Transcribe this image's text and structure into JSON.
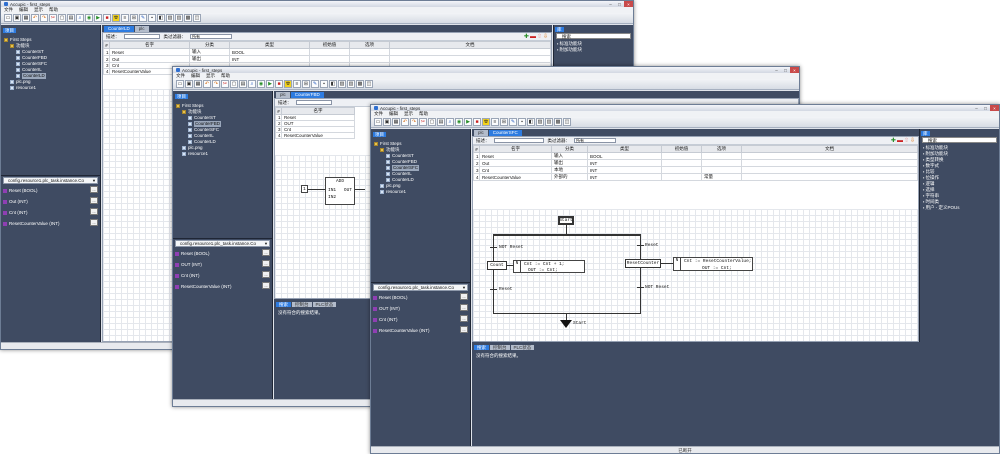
{
  "app": {
    "title": "Accupic - first_steps",
    "menu": [
      "文件",
      "编辑",
      "显示",
      "帮助"
    ]
  },
  "toolbar_glyphs": [
    "▭",
    "▣",
    "▦",
    "↶",
    "↷",
    "✂",
    "▢",
    "▤",
    "⌕",
    "◉",
    "▶",
    "■",
    "☢",
    "≡",
    "⊞",
    "✎",
    "▪",
    "◧",
    "▨",
    "▥",
    "▩",
    "◫"
  ],
  "tree": {
    "tab": "项目",
    "root": "First Steps",
    "folder": "功能块",
    "items": [
      "CounterST",
      "CounterFBD",
      "CounterSFC",
      "CounterIL",
      "CounterLD"
    ],
    "extra": [
      "plc.png",
      "resource1"
    ]
  },
  "windows": [
    {
      "doc_tab_active": "CounterLD",
      "doc_tab_other": "plc",
      "selected_item": "CounterLD"
    },
    {
      "doc_tab_active": "CounterFBD",
      "doc_tab_other": "plc",
      "selected_item": "CounterFBD"
    },
    {
      "doc_tab_active": "CounterSFC",
      "doc_tab_other": "plc",
      "selected_item": "CounterSFC"
    }
  ],
  "filter": {
    "label": "描述：",
    "class_label": "类过滤器：",
    "class_value": "所有"
  },
  "table": {
    "headers": [
      "#",
      "名字",
      "分类",
      "类型",
      "初始值",
      "选项",
      "文档"
    ],
    "rows": [
      [
        "1",
        "Reset",
        "输入",
        "BOOL",
        "",
        "",
        ""
      ],
      [
        "2",
        "Out",
        "输出",
        "INT",
        "",
        "",
        ""
      ],
      [
        "3",
        "Cnt",
        "本地",
        "INT",
        "",
        "",
        ""
      ],
      [
        "4",
        "ResetCounterValue",
        "外部的",
        "INT",
        "",
        "常量",
        ""
      ]
    ],
    "w1_rows": [
      [
        "1",
        "Reset",
        "输入",
        "BOOL",
        "",
        "",
        ""
      ],
      [
        "2",
        "Out",
        "输出",
        "INT",
        "",
        "",
        ""
      ],
      [
        "3",
        "Cnt",
        "",
        "",
        "",
        "",
        ""
      ],
      [
        "4",
        "ResetCounterValue",
        "",
        "",
        "",
        "",
        ""
      ]
    ],
    "w2_rows": [
      [
        "1",
        "Reset"
      ],
      [
        "2",
        "OUT"
      ],
      [
        "3",
        "Cnt"
      ],
      [
        "4",
        "ResetCounterValue"
      ]
    ]
  },
  "instance": {
    "header": "config.resource1.plc_task.instance.Co",
    "vars": [
      "Reset (BOOL)",
      "OUT (INT)",
      "Cnt (INT)",
      "ResetCounterValue (INT)"
    ],
    "vars_w1": [
      "Reset (BOOL)",
      "Out (INT)",
      "Cnt (INT)",
      "ResetCounterValue (INT)"
    ],
    "btn": "..."
  },
  "library": {
    "tab": "库",
    "search": "搜索",
    "items": [
      "标准功能块",
      "附加功能块",
      "类型转换",
      "数字式",
      "比较",
      "位操作",
      "逻辑",
      "选择",
      "字符串",
      "时间类",
      "用户 - 定义POUs"
    ]
  },
  "bottom": {
    "tabs": [
      "搜索",
      "控制台",
      "PLC状态"
    ],
    "message": "没有符合的搜索结果。"
  },
  "status": {
    "text": "已断开"
  },
  "fbd": {
    "block": "ADD",
    "in1": "IN1",
    "in2": "IN2",
    "out": "OUT",
    "const": "1"
  },
  "sfc": {
    "start": "Start",
    "count": "Count",
    "reset_counter": "ResetCounter",
    "act1a": "Cnt := Cnt + 1;",
    "act1b": "OUT := Cnt;",
    "act2a": "Cnt := ResetCounterValue;",
    "act2b": "OUT := Cnt;",
    "q1": "N",
    "q2": "N",
    "t_not_reset": "NOT Reset",
    "t_reset": "Reset",
    "t_reset2": "Reset",
    "t_not_reset2": "NOT Reset",
    "jump": "Start"
  }
}
